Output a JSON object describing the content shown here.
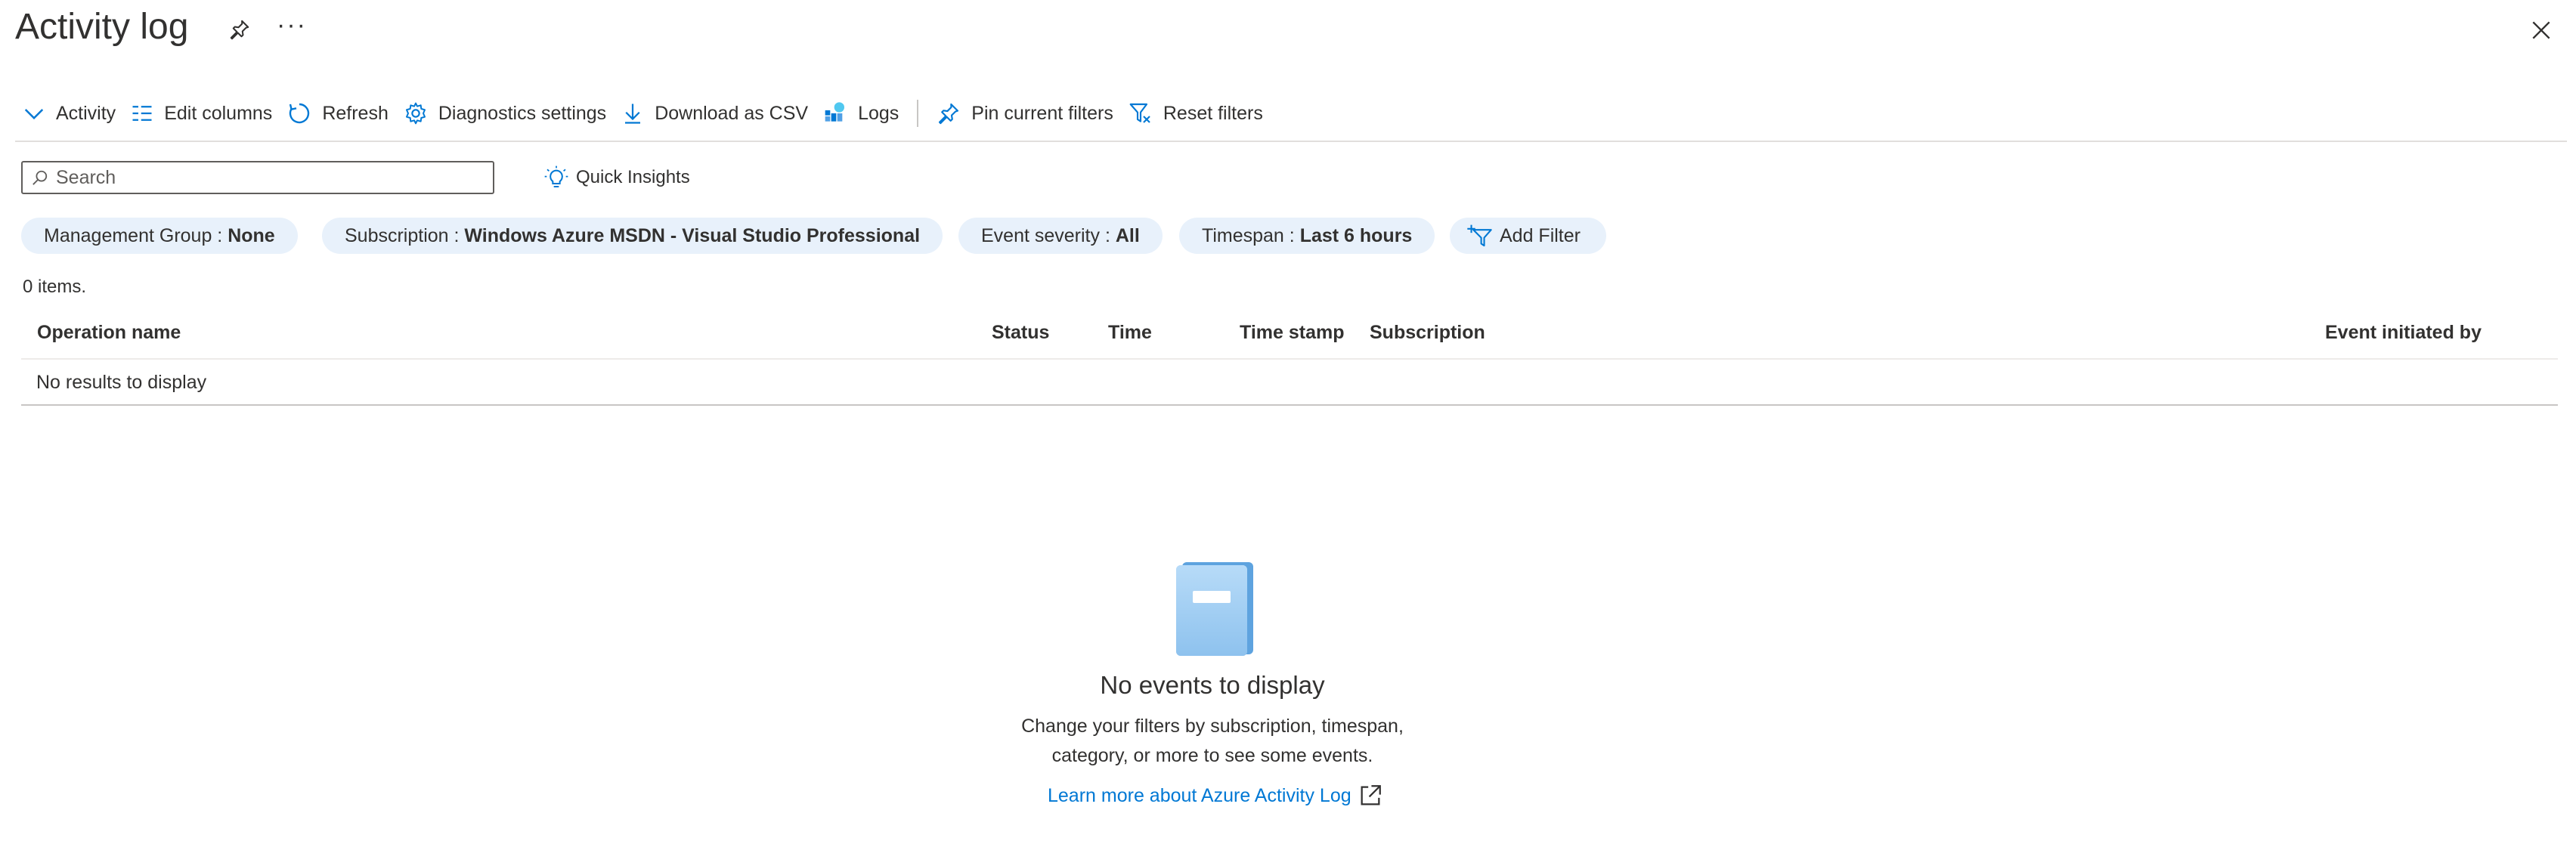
{
  "header": {
    "title": "Activity log",
    "more_label": "···",
    "pin_icon": "pin-icon",
    "close_icon": "close-icon"
  },
  "toolbar": {
    "activity": "Activity",
    "edit_columns": "Edit columns",
    "refresh": "Refresh",
    "diagnostics": "Diagnostics settings",
    "download_csv": "Download as CSV",
    "logs": "Logs",
    "pin_filters": "Pin current filters",
    "reset_filters": "Reset filters"
  },
  "search": {
    "placeholder": "Search",
    "value": ""
  },
  "quick_insights": "Quick Insights",
  "filters": {
    "management_group": {
      "label": "Management Group : ",
      "value": "None"
    },
    "subscription": {
      "label": "Subscription : ",
      "value": "Windows Azure MSDN - Visual Studio Professional"
    },
    "event_severity": {
      "label": "Event severity : ",
      "value": "All"
    },
    "timespan": {
      "label": "Timespan : ",
      "value": "Last 6 hours"
    },
    "add_filter": "Add Filter"
  },
  "items_count": "0 items.",
  "table": {
    "columns": [
      "Operation name",
      "Status",
      "Time",
      "Time stamp",
      "Subscription",
      "Event initiated by"
    ],
    "empty_row": "No results to display"
  },
  "empty_state": {
    "title": "No events to display",
    "line1": "Change your filters by subscription, timespan,",
    "line2": "category, or more to see some events.",
    "link": "Learn more about Azure Activity Log"
  },
  "colors": {
    "accent": "#0078d4",
    "pill_background": "#e8f1fb",
    "text": "#323130"
  }
}
